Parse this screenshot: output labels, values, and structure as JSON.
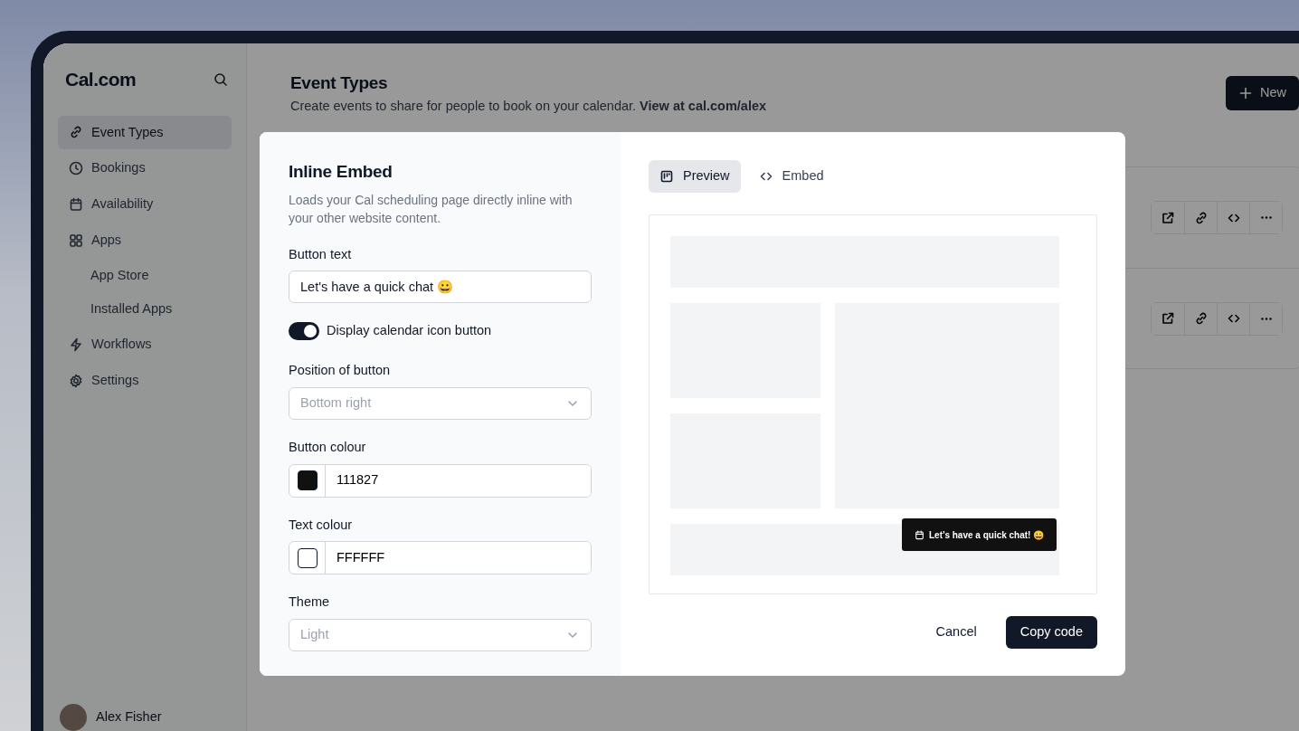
{
  "brand": "Cal.com",
  "nav": [
    {
      "label": "Event Types",
      "selected": true
    },
    {
      "label": "Bookings",
      "selected": false
    },
    {
      "label": "Availability",
      "selected": false
    },
    {
      "label": "Apps",
      "selected": false,
      "children": [
        {
          "label": "App Store",
          "selected": false
        },
        {
          "label": "Installed Apps",
          "selected": false
        }
      ]
    },
    {
      "label": "Workflows",
      "selected": false
    },
    {
      "label": "Settings",
      "selected": false
    }
  ],
  "user": {
    "name": "Alex Fisher"
  },
  "page": {
    "title": "Event Types",
    "subtitle": "Create events to share for people to book on your calendar. **View at cal.com/alex**",
    "new_button": "New"
  },
  "event_rows": [
    {
      "kind": "event"
    },
    {
      "kind": "event"
    }
  ],
  "modal": {
    "title": "Inline Embed",
    "description": "Loads your Cal scheduling page directly inline with your other website content.",
    "fields": [
      {
        "kind": "text",
        "label": "Button text",
        "value": "Let's have a quick chat 😀"
      },
      {
        "kind": "toggle",
        "label": "Display calendar icon button",
        "on": true
      },
      {
        "kind": "select",
        "label": "Position of button",
        "placeholder": "Bottom right"
      },
      {
        "kind": "color",
        "label": "Button colour",
        "value": "111827",
        "color": "#111111"
      },
      {
        "kind": "color",
        "label": "Text colour",
        "value": "FFFFFF",
        "color": "#ffffff"
      },
      {
        "kind": "select",
        "label": "Theme",
        "placeholder": "Light"
      }
    ],
    "tabs": [
      {
        "label": "Preview",
        "selected": true
      },
      {
        "label": "Embed",
        "selected": false
      }
    ],
    "preview_button": {
      "label": "Let’s have a quick chat! 😀",
      "show_icon": true
    },
    "buttons": [
      {
        "label": "Cancel",
        "kind": "secondary"
      },
      {
        "label": "Copy code",
        "kind": "primary"
      }
    ]
  }
}
